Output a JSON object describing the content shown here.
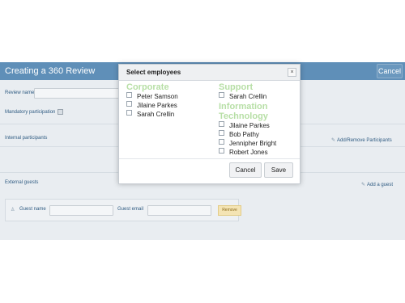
{
  "app": {
    "title": "Creating a 360 Review",
    "cancel_label": "Cancel",
    "review_name_label": "Review name",
    "mandatory_label": "Mandatory participation",
    "internal_label": "Internal participants",
    "add_remove_label": "Add/Remove Participants",
    "external_label": "External guests",
    "add_guest_label": "Add a guest",
    "guest_name_label": "Guest name",
    "guest_email_label": "Guest email",
    "remove_label": "Remove"
  },
  "modal": {
    "title": "Select employees",
    "close_glyph": "×",
    "groups": [
      {
        "name": "Corporate",
        "employees": [
          "Peter Samson",
          "Jilaine Parkes",
          "Sarah Crellin"
        ]
      },
      {
        "name": "Support",
        "employees": [
          "Sarah Crellin"
        ]
      },
      {
        "name": "Information Technology",
        "employees": [
          "Jilaine Parkes",
          "Bob Pathy",
          "Jennipher Bright",
          "Robert Jones"
        ]
      }
    ],
    "cancel_label": "Cancel",
    "save_label": "Save"
  }
}
